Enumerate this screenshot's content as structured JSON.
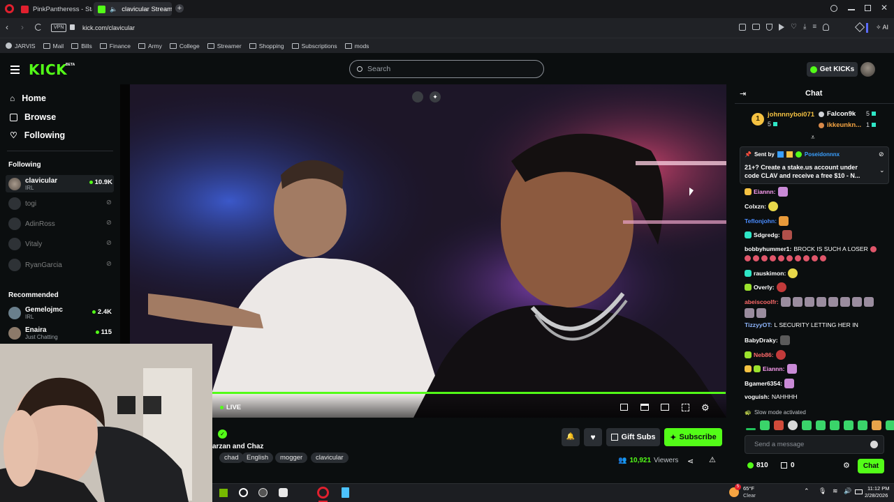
{
  "browser": {
    "tabs": [
      {
        "label": "PinkPantheress - Statesid"
      },
      {
        "label": "clavicular Stream - Wa"
      }
    ],
    "url": "kick.com/clavicular",
    "vpn_label": "VPN",
    "ai_label": "AI",
    "bookmarks": [
      "JARVIS",
      "Mail",
      "Bills",
      "Finance",
      "Army",
      "College",
      "Streamer",
      "Shopping",
      "Subscriptions",
      "mods"
    ]
  },
  "header": {
    "logo": "KICK",
    "logo_badge": "BETA",
    "search_placeholder": "Search",
    "get_kicks_label": "Get KICKs"
  },
  "sidebar": {
    "nav": [
      {
        "label": "Home",
        "icon": "home-icon"
      },
      {
        "label": "Browse",
        "icon": "browse-icon"
      },
      {
        "label": "Following",
        "icon": "heart-icon"
      }
    ],
    "following_title": "Following",
    "following": [
      {
        "name": "clavicular",
        "sub": "IRL",
        "viewers": "10.9K",
        "live": true
      },
      {
        "name": "togi",
        "live": false
      },
      {
        "name": "AdinRoss",
        "live": false
      },
      {
        "name": "Vitaly",
        "live": false
      },
      {
        "name": "RyanGarcia",
        "live": false
      }
    ],
    "recommended_title": "Recommended",
    "recommended": [
      {
        "name": "Gemelojmc",
        "sub": "IRL",
        "viewers": "2.4K"
      },
      {
        "name": "Enaira",
        "sub": "Just Chatting",
        "viewers": "115"
      }
    ]
  },
  "player": {
    "live_label": "LIVE",
    "progress": 1.0
  },
  "channel": {
    "title": "arzan and Chaz",
    "tags": [
      "chad",
      "English",
      "mogger",
      "clavicular"
    ],
    "gift_label": "Gift Subs",
    "subscribe_label": "Subscribe",
    "viewers_count": "10,921",
    "viewers_label": "Viewers"
  },
  "chat": {
    "title": "Chat",
    "leaderboard": [
      {
        "name": "johnnnyboi071",
        "count": "5",
        "rank": "1"
      },
      {
        "name": "Falcon9k",
        "count": "5"
      },
      {
        "name": "ikkeunkn...",
        "count": "1"
      }
    ],
    "pinned": {
      "sent_by_label": "Sent by",
      "sender": "Poseidonnnx",
      "text_line1": "21+? Create a stake.us account under",
      "text_line2": "code CLAV and receive a free $10 - N..."
    },
    "messages": [
      {
        "user": "Eiannn:",
        "color": "#ff9ff3",
        "text": ""
      },
      {
        "user": "Colxzn:",
        "color": "#ffffff",
        "text": ""
      },
      {
        "user": "Teflonjohn:",
        "color": "#4a8cff",
        "text": ""
      },
      {
        "user": "Sdgredg:",
        "color": "#ffffff",
        "text": ""
      },
      {
        "user": "bobbyhummer1:",
        "color": "#ffffff",
        "text": "BROCK IS SUCH A LOSER"
      },
      {
        "user": "rauskimon:",
        "color": "#ffffff",
        "text": ""
      },
      {
        "user": "Overly:",
        "color": "#ffffff",
        "text": ""
      },
      {
        "user": "abeiscoolfr:",
        "color": "#ff6a6a",
        "text": ""
      },
      {
        "user": "TizzyyOT:",
        "color": "#8fb7ff",
        "text": "L SECURITY LETTING HER IN"
      },
      {
        "user": "BabyDraky:",
        "color": "#ffffff",
        "text": ""
      },
      {
        "user": "Neb86:",
        "color": "#ff6a6a",
        "text": ""
      },
      {
        "user": "Eiannn:",
        "color": "#ff9ff3",
        "text": ""
      },
      {
        "user": "Bgamer6354:",
        "color": "#ffffff",
        "text": ""
      },
      {
        "user": "voguish:",
        "color": "#ffffff",
        "text": "NAHHHH"
      }
    ],
    "slow_mode": "Slow mode activated",
    "send_placeholder": "Send a message",
    "kicks_count": "810",
    "points_count": "0",
    "chat_button": "Chat"
  },
  "taskbar": {
    "weather_temp": "65°F",
    "weather_desc": "Clear",
    "weather_badge": "5",
    "time": "11:12 PM",
    "date": "2/28/2026"
  },
  "colors": {
    "kick_green": "#53fc18",
    "bg": "#0b0e0f"
  }
}
